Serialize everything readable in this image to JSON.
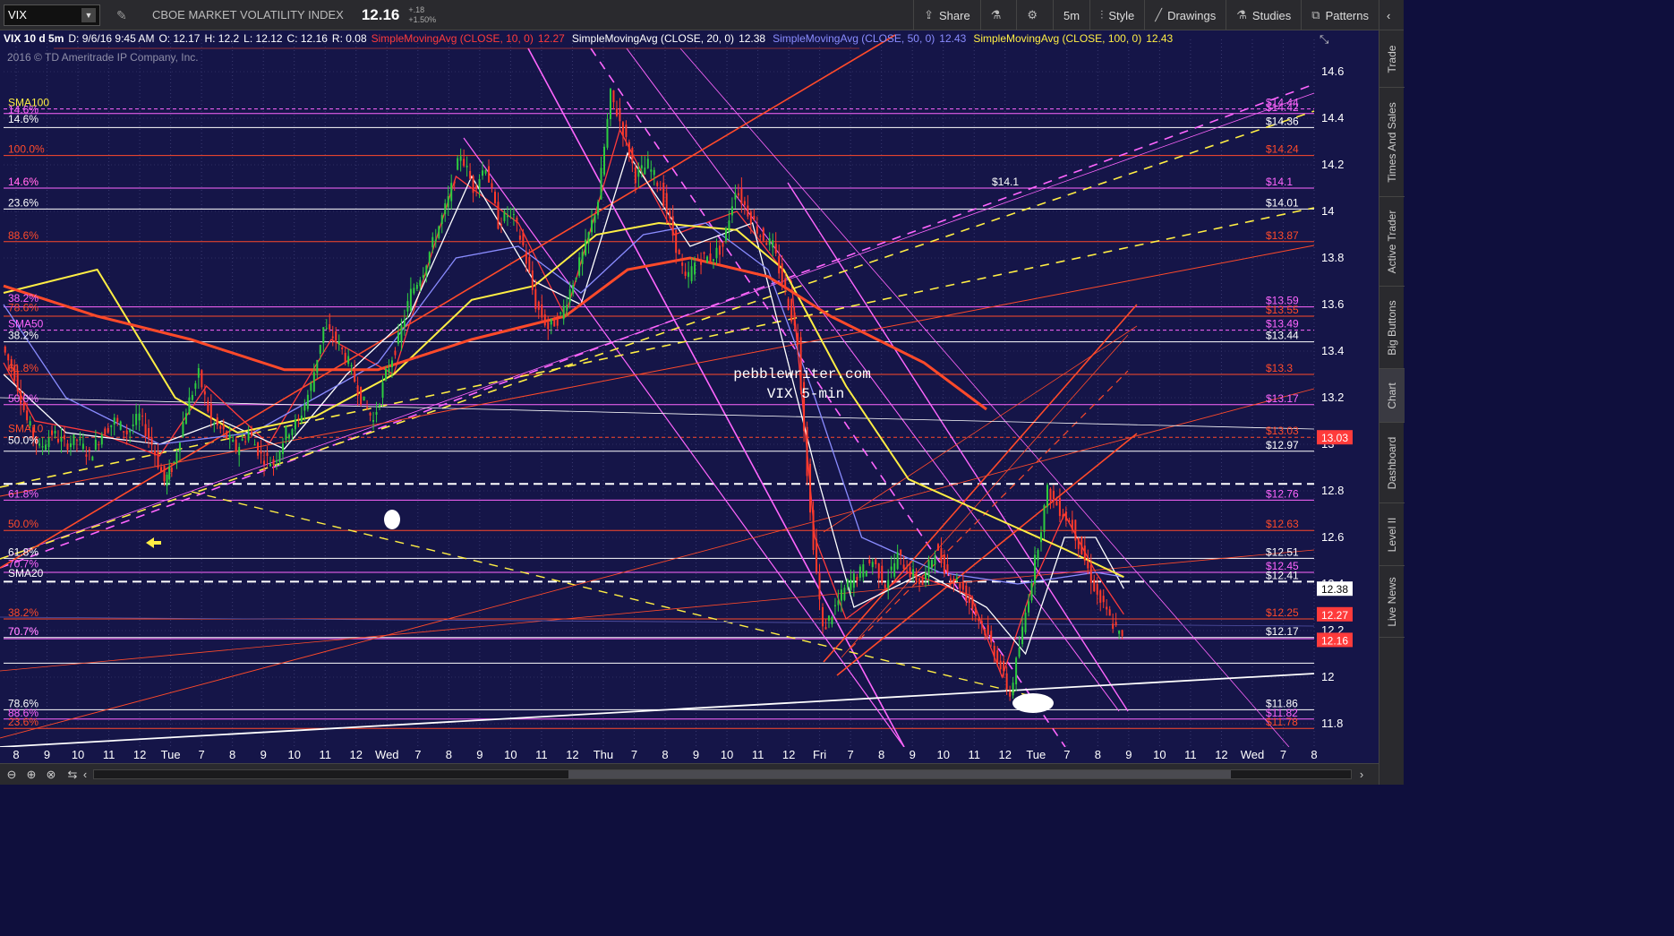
{
  "toolbar": {
    "symbol": "VIX",
    "description": "CBOE MARKET VOLATILITY INDEX",
    "last": "12.16",
    "change": "+.18",
    "change_pct": "+1.50%",
    "buttons": {
      "share": "Share",
      "timeframe": "5m",
      "style": "Style",
      "drawings": "Drawings",
      "studies": "Studies",
      "patterns": "Patterns"
    },
    "icons": [
      "pencil-icon",
      "share-icon",
      "flask-icon",
      "gear-icon",
      "style-icon",
      "drawings-icon",
      "studies-icon",
      "patterns-icon"
    ]
  },
  "header": {
    "label": "VIX 10 d 5m",
    "date": "D: 9/6/16 9:45 AM",
    "open": "O: 12.17",
    "high": "H: 12.2",
    "low": "L: 12.12",
    "close": "C: 12.16",
    "range": "R: 0.08",
    "studies": [
      {
        "name": "SimpleMovingAvg (CLOSE, 10, 0)",
        "value": "12.27",
        "color": "#ff3b3b"
      },
      {
        "name": "SimpleMovingAvg (CLOSE, 20, 0)",
        "value": "12.38",
        "color": "#ffffff"
      },
      {
        "name": "SimpleMovingAvg (CLOSE, 50, 0)",
        "value": "12.43",
        "color": "#8a8cff"
      },
      {
        "name": "SimpleMovingAvg (CLOSE, 100, 0)",
        "value": "12.43",
        "color": "#ffee44"
      }
    ],
    "copyright": "2016 © TD Ameritrade IP Company, Inc."
  },
  "side_tabs": [
    "Trade",
    "Times And Sales",
    "Active Trader",
    "Big Buttons",
    "Chart",
    "Dashboard",
    "Level II",
    "Live News"
  ],
  "colors": {
    "background": "#151548",
    "candle_up": "#2ecc40",
    "candle_down": "#ff3a2a",
    "fib_red": "#ff4a2a",
    "pink": "#ff66ff",
    "yellow": "#ffee44"
  },
  "chart_data": {
    "type": "candlestick",
    "symbol": "VIX",
    "interval": "5m",
    "watermark": [
      "pebblewriter.com",
      "VIX 5-min"
    ],
    "ylim": [
      11.7,
      14.7
    ],
    "y_ticks": [
      11.8,
      12,
      12.2,
      12.4,
      12.6,
      12.8,
      13,
      13.2,
      13.4,
      13.6,
      13.8,
      14,
      14.2,
      14.4,
      14.6
    ],
    "x_ticks": [
      "8",
      "9",
      "10",
      "11",
      "12",
      "Tue",
      "7",
      "8",
      "9",
      "10",
      "11",
      "12",
      "Wed",
      "7",
      "8",
      "9",
      "10",
      "11",
      "12",
      "Thu",
      "7",
      "8",
      "9",
      "10",
      "11",
      "12",
      "Fri",
      "7",
      "8",
      "9",
      "10",
      "11",
      "12",
      "Tue",
      "7",
      "8",
      "9",
      "10",
      "11",
      "12",
      "Wed",
      "7",
      "8"
    ],
    "price_badges": [
      {
        "value": "13.03",
        "color": "#ff3b3b"
      },
      {
        "value": "12.38",
        "color": "#ffffff"
      },
      {
        "value": "12.27",
        "color": "#ff3b3b"
      },
      {
        "value": "12.16",
        "color": "#ff3b3b"
      }
    ],
    "levels_right": [
      {
        "value": 14.44,
        "label": "$14.44",
        "color": "#ff66ff",
        "style": "dash"
      },
      {
        "value": 14.42,
        "label": "$14.42",
        "color": "#ff66ff",
        "style": "solid"
      },
      {
        "value": 14.36,
        "label": "$14.36",
        "color": "#ffffff",
        "style": "solid"
      },
      {
        "value": 14.24,
        "label": "$14.24",
        "color": "#ff4a2a",
        "style": "solid"
      },
      {
        "value": 14.1,
        "label": "$14.1",
        "color": "#ff66ff",
        "style": "solid"
      },
      {
        "value": 14.01,
        "label": "$14.01",
        "color": "#ffffff",
        "style": "solid"
      },
      {
        "value": 13.87,
        "label": "$13.87",
        "color": "#ff4a2a",
        "style": "solid"
      },
      {
        "value": 13.59,
        "label": "$13.59",
        "color": "#ff66ff",
        "style": "solid"
      },
      {
        "value": 13.55,
        "label": "$13.55",
        "color": "#ff4a2a",
        "style": "solid"
      },
      {
        "value": 13.49,
        "label": "$13.49",
        "color": "#ff66ff",
        "style": "dash"
      },
      {
        "value": 13.44,
        "label": "$13.44",
        "color": "#ffffff",
        "style": "solid"
      },
      {
        "value": 13.3,
        "label": "$13.3",
        "color": "#ff4a2a",
        "style": "solid"
      },
      {
        "value": 13.17,
        "label": "$13.17",
        "color": "#ff66ff",
        "style": "solid"
      },
      {
        "value": 13.03,
        "label": "$13.03",
        "color": "#ff4a2a",
        "style": "dash"
      },
      {
        "value": 12.97,
        "label": "$12.97",
        "color": "#ffffff",
        "style": "solid"
      },
      {
        "value": 12.83,
        "label": "",
        "color": "#ffffff",
        "style": "dash"
      },
      {
        "value": 12.76,
        "label": "$12.76",
        "color": "#ff66ff",
        "style": "solid"
      },
      {
        "value": 12.63,
        "label": "$12.63",
        "color": "#ff4a2a",
        "style": "solid"
      },
      {
        "value": 12.51,
        "label": "$12.51",
        "color": "#ffffff",
        "style": "solid"
      },
      {
        "value": 12.45,
        "label": "$12.45",
        "color": "#ff66ff",
        "style": "solid"
      },
      {
        "value": 12.41,
        "label": "$12.41",
        "color": "#ffffff",
        "style": "dash"
      },
      {
        "value": 12.25,
        "label": "$12.25",
        "color": "#ff4a2a",
        "style": "solid"
      },
      {
        "value": 12.17,
        "label": "$12.17",
        "color": "#ffffff",
        "style": "solid"
      },
      {
        "value": 12.165,
        "label": "",
        "color": "#ff66ff",
        "style": "solid"
      },
      {
        "value": 12.06,
        "label": "",
        "color": "#ffffff",
        "style": "solid"
      },
      {
        "value": 11.86,
        "label": "$11.86",
        "color": "#ffffff",
        "style": "solid"
      },
      {
        "value": 11.82,
        "label": "$11.82",
        "color": "#ff66ff",
        "style": "solid"
      },
      {
        "value": 11.78,
        "label": "$11.78",
        "color": "#ff4a2a",
        "style": "solid"
      }
    ],
    "levels_left": [
      {
        "value": 14.44,
        "label": "SMA100",
        "color": "#ffee44"
      },
      {
        "value": 14.41,
        "label": "14.6%",
        "color": "#ff66ff"
      },
      {
        "value": 14.37,
        "label": "14.6%",
        "color": "#ffffff"
      },
      {
        "value": 14.24,
        "label": "100.0%",
        "color": "#ff4a2a"
      },
      {
        "value": 14.1,
        "label": "14.6%",
        "color": "#ff4a2a"
      },
      {
        "value": 14.1,
        "label": "14.6%",
        "color": "#ff66ff"
      },
      {
        "value": 14.01,
        "label": "23.6%",
        "color": "#ffffff"
      },
      {
        "value": 13.87,
        "label": "88.6%",
        "color": "#ff4a2a"
      },
      {
        "value": 13.6,
        "label": "38.2%",
        "color": "#ff66ff"
      },
      {
        "value": 13.56,
        "label": "78.6%",
        "color": "#ff4a2a"
      },
      {
        "value": 13.49,
        "label": "SMA50",
        "color": "#ff66ff"
      },
      {
        "value": 13.44,
        "label": "38.2%",
        "color": "#ffffff"
      },
      {
        "value": 13.3,
        "label": "61.8%",
        "color": "#ff4a2a"
      },
      {
        "value": 13.17,
        "label": "50.0%",
        "color": "#ff66ff"
      },
      {
        "value": 13.04,
        "label": "SMA10",
        "color": "#ff4a2a"
      },
      {
        "value": 12.99,
        "label": "50.0%",
        "color": "#ffffff"
      },
      {
        "value": 12.76,
        "label": "61.8%",
        "color": "#ff66ff"
      },
      {
        "value": 12.63,
        "label": "50.0%",
        "color": "#ff4a2a"
      },
      {
        "value": 12.51,
        "label": "61.8%",
        "color": "#ffffff"
      },
      {
        "value": 12.46,
        "label": "70.7%",
        "color": "#ff66ff"
      },
      {
        "value": 12.42,
        "label": "SMA20",
        "color": "#ffffff"
      },
      {
        "value": 12.25,
        "label": "38.2%",
        "color": "#ff4a2a"
      },
      {
        "value": 12.17,
        "label": "70.7%",
        "color": "#ffffff"
      },
      {
        "value": 12.17,
        "label": "70.7%",
        "color": "#ff66ff"
      },
      {
        "value": 11.86,
        "label": "78.6%",
        "color": "#ffffff"
      },
      {
        "value": 11.82,
        "label": "88.6%",
        "color": "#ff66ff"
      },
      {
        "value": 11.78,
        "label": "23.6%",
        "color": "#ff4a2a"
      }
    ],
    "extra_labels": [
      {
        "text": "$14.1",
        "value": 14.1,
        "color": "#ffffff"
      }
    ],
    "price_path": [
      [
        0,
        13.42
      ],
      [
        8,
        13.3
      ],
      [
        16,
        13.1
      ],
      [
        24,
        12.98
      ],
      [
        32,
        13.05
      ],
      [
        40,
        13.0
      ],
      [
        48,
        13.02
      ],
      [
        56,
        12.95
      ],
      [
        64,
        13.05
      ],
      [
        72,
        13.1
      ],
      [
        80,
        13.05
      ],
      [
        88,
        13.12
      ],
      [
        96,
        13.0
      ],
      [
        104,
        12.84
      ],
      [
        110,
        12.92
      ],
      [
        118,
        13.15
      ],
      [
        126,
        13.3
      ],
      [
        134,
        13.1
      ],
      [
        142,
        13.05
      ],
      [
        150,
        12.98
      ],
      [
        158,
        13.05
      ],
      [
        166,
        12.95
      ],
      [
        174,
        12.92
      ],
      [
        182,
        13.05
      ],
      [
        190,
        13.1
      ],
      [
        198,
        13.25
      ],
      [
        206,
        13.5
      ],
      [
        214,
        13.45
      ],
      [
        222,
        13.35
      ],
      [
        230,
        13.2
      ],
      [
        238,
        13.1
      ],
      [
        246,
        13.3
      ],
      [
        254,
        13.45
      ],
      [
        262,
        13.65
      ],
      [
        270,
        13.75
      ],
      [
        278,
        13.9
      ],
      [
        286,
        14.05
      ],
      [
        294,
        14.25
      ],
      [
        302,
        14.1
      ],
      [
        310,
        14.2
      ],
      [
        318,
        13.95
      ],
      [
        326,
        14.0
      ],
      [
        334,
        13.85
      ],
      [
        342,
        13.6
      ],
      [
        350,
        13.5
      ],
      [
        358,
        13.55
      ],
      [
        366,
        13.7
      ],
      [
        374,
        13.85
      ],
      [
        382,
        14.05
      ],
      [
        390,
        14.5
      ],
      [
        398,
        14.35
      ],
      [
        406,
        14.15
      ],
      [
        414,
        14.2
      ],
      [
        422,
        14.1
      ],
      [
        430,
        13.9
      ],
      [
        438,
        13.7
      ],
      [
        446,
        13.8
      ],
      [
        454,
        13.8
      ],
      [
        462,
        13.85
      ],
      [
        470,
        14.1
      ],
      [
        478,
        14.0
      ],
      [
        486,
        13.9
      ],
      [
        494,
        13.85
      ],
      [
        502,
        13.65
      ],
      [
        510,
        13.45
      ],
      [
        518,
        12.7
      ],
      [
        526,
        12.2
      ],
      [
        534,
        12.3
      ],
      [
        542,
        12.4
      ],
      [
        550,
        12.45
      ],
      [
        558,
        12.5
      ],
      [
        566,
        12.4
      ],
      [
        574,
        12.52
      ],
      [
        582,
        12.45
      ],
      [
        590,
        12.4
      ],
      [
        598,
        12.55
      ],
      [
        606,
        12.45
      ],
      [
        614,
        12.4
      ],
      [
        622,
        12.3
      ],
      [
        630,
        12.2
      ],
      [
        638,
        12.08
      ],
      [
        646,
        11.92
      ],
      [
        654,
        12.2
      ],
      [
        662,
        12.5
      ],
      [
        670,
        12.8
      ],
      [
        678,
        12.72
      ],
      [
        686,
        12.65
      ],
      [
        694,
        12.5
      ],
      [
        702,
        12.35
      ],
      [
        710,
        12.25
      ],
      [
        718,
        12.16
      ]
    ],
    "moving_averages": [
      {
        "name": "SMA10",
        "color": "#ff3b3b",
        "values": [
          [
            0,
            13.35
          ],
          [
            20,
            13.1
          ],
          [
            60,
            13.05
          ],
          [
            100,
            12.95
          ],
          [
            130,
            13.25
          ],
          [
            170,
            13.0
          ],
          [
            210,
            13.45
          ],
          [
            250,
            13.3
          ],
          [
            290,
            14.15
          ],
          [
            330,
            13.95
          ],
          [
            360,
            13.55
          ],
          [
            395,
            14.35
          ],
          [
            430,
            13.9
          ],
          [
            470,
            14.0
          ],
          [
            505,
            13.7
          ],
          [
            520,
            12.6
          ],
          [
            540,
            12.25
          ],
          [
            580,
            12.45
          ],
          [
            620,
            12.35
          ],
          [
            640,
            12.0
          ],
          [
            660,
            12.4
          ],
          [
            680,
            12.7
          ],
          [
            700,
            12.45
          ],
          [
            718,
            12.27
          ]
        ]
      },
      {
        "name": "SMA20",
        "color": "#ffffff",
        "values": [
          [
            0,
            13.3
          ],
          [
            40,
            13.05
          ],
          [
            100,
            13.0
          ],
          [
            140,
            13.1
          ],
          [
            180,
            12.98
          ],
          [
            220,
            13.3
          ],
          [
            260,
            13.55
          ],
          [
            300,
            14.15
          ],
          [
            340,
            13.7
          ],
          [
            370,
            13.6
          ],
          [
            400,
            14.25
          ],
          [
            440,
            13.85
          ],
          [
            480,
            13.95
          ],
          [
            520,
            12.9
          ],
          [
            545,
            12.3
          ],
          [
            590,
            12.45
          ],
          [
            630,
            12.3
          ],
          [
            655,
            12.1
          ],
          [
            680,
            12.6
          ],
          [
            700,
            12.6
          ],
          [
            718,
            12.38
          ]
        ]
      },
      {
        "name": "SMA50",
        "color": "#8a8cff",
        "values": [
          [
            0,
            13.6
          ],
          [
            40,
            13.2
          ],
          [
            100,
            13.0
          ],
          [
            160,
            13.05
          ],
          [
            200,
            13.2
          ],
          [
            240,
            13.35
          ],
          [
            290,
            13.8
          ],
          [
            330,
            13.85
          ],
          [
            370,
            13.65
          ],
          [
            410,
            13.9
          ],
          [
            450,
            13.95
          ],
          [
            490,
            13.75
          ],
          [
            520,
            13.2
          ],
          [
            550,
            12.6
          ],
          [
            600,
            12.45
          ],
          [
            650,
            12.4
          ],
          [
            700,
            12.45
          ],
          [
            718,
            12.43
          ]
        ]
      },
      {
        "name": "SMA100",
        "color": "#ffee44",
        "values": [
          [
            0,
            13.65
          ],
          [
            60,
            13.75
          ],
          [
            110,
            13.2
          ],
          [
            150,
            13.05
          ],
          [
            200,
            13.12
          ],
          [
            250,
            13.3
          ],
          [
            300,
            13.62
          ],
          [
            340,
            13.68
          ],
          [
            380,
            13.9
          ],
          [
            420,
            13.95
          ],
          [
            470,
            13.92
          ],
          [
            500,
            13.75
          ],
          [
            540,
            13.25
          ],
          [
            580,
            12.85
          ],
          [
            630,
            12.7
          ],
          [
            680,
            12.55
          ],
          [
            718,
            12.43
          ]
        ]
      },
      {
        "name": "SMA200",
        "color": "#ff4a2a",
        "values": [
          [
            0,
            13.68
          ],
          [
            60,
            13.55
          ],
          [
            120,
            13.45
          ],
          [
            180,
            13.32
          ],
          [
            240,
            13.32
          ],
          [
            300,
            13.45
          ],
          [
            360,
            13.55
          ],
          [
            400,
            13.75
          ],
          [
            440,
            13.8
          ],
          [
            490,
            13.72
          ],
          [
            530,
            13.55
          ],
          [
            590,
            13.35
          ],
          [
            630,
            13.15
          ]
        ]
      }
    ]
  }
}
